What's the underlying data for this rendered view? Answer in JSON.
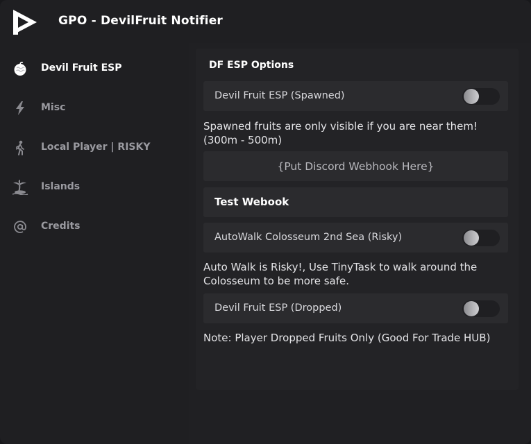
{
  "app": {
    "title": "GPO - DevilFruit Notifier",
    "logo_icon": "play-logo-icon"
  },
  "sidebar": {
    "items": [
      {
        "label": "Devil Fruit ESP",
        "icon": "fruit-icon",
        "active": true
      },
      {
        "label": "Misc",
        "icon": "lightning-icon",
        "active": false
      },
      {
        "label": "Local Player | RISKY",
        "icon": "walking-person-icon",
        "active": false
      },
      {
        "label": "Islands",
        "icon": "island-icon",
        "active": false
      },
      {
        "label": "Credits",
        "icon": "at-sign-icon",
        "active": false
      }
    ]
  },
  "main": {
    "section_title": "DF ESP Options",
    "toggles": [
      {
        "label": "Devil Fruit ESP (Spawned)",
        "state": false
      },
      {
        "label": "AutoWalk Colosseum 2nd Sea (Risky)",
        "state": false
      },
      {
        "label": "Devil Fruit ESP (Dropped)",
        "state": false
      }
    ],
    "notes": [
      "Spawned fruits are only visible if you are near them!(300m - 500m)",
      "Auto Walk is Risky!, Use TinyTask to walk around the Colosseum to be more safe.",
      "Note: Player Dropped Fruits Only (Good For Trade HUB)"
    ],
    "webhook_input": {
      "placeholder": "{Put Discord Webhook Here}",
      "value": ""
    },
    "test_button_label": "Test Webook"
  },
  "colors": {
    "background": "#1f1f22",
    "panel": "#232326",
    "row": "#2b2b2e",
    "text_primary": "#ffffff",
    "text_muted": "#9a9aa0"
  }
}
